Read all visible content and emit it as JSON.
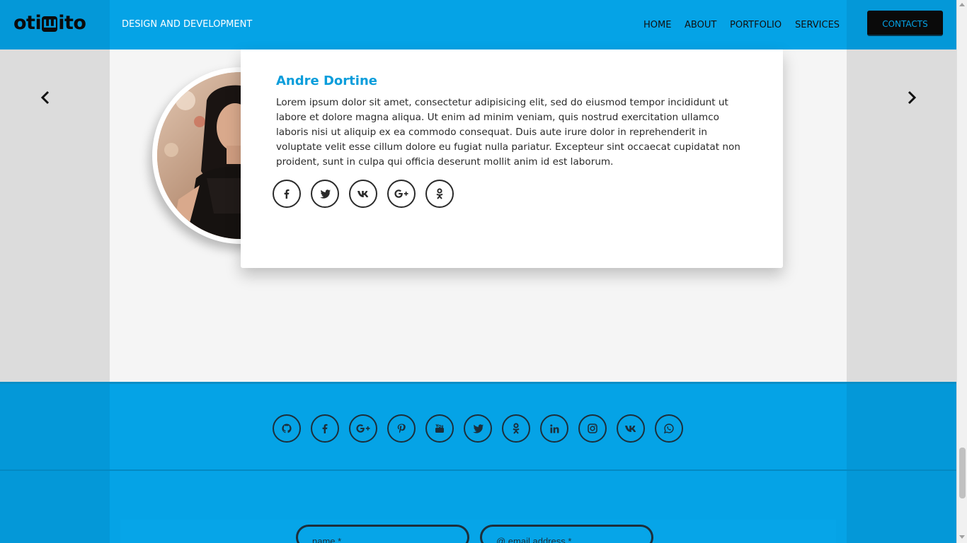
{
  "header": {
    "logo_left": "oti",
    "logo_mid": "Ш",
    "logo_right": "ito",
    "tagline": "DESIGN AND DEVELOPMENT",
    "nav": [
      "HOME",
      "ABOUT",
      "PORTFOLIO",
      "SERVICES"
    ],
    "contacts_label": "CONTACTS"
  },
  "testimonial": {
    "name": "Andre Dortine",
    "text": "Lorem ipsum dolor sit amet, consectetur adipisicing elit, sed do eiusmod tempor incididunt ut labore et dolore magna aliqua. Ut enim ad minim veniam, quis nostrud exercitation ullamco laboris nisi ut aliquip ex ea commodo consequat. Duis aute irure dolor in reprehenderit in voluptate velit esse cillum dolore eu fugiat nulla pariatur. Excepteur sint occaecat cupidatat non proident, sunt in culpa qui officia deserunt mollit anim id est laborum.",
    "social_icons": [
      "facebook-icon",
      "twitter-icon",
      "vk-icon",
      "google-plus-icon",
      "odnoklassniki-icon"
    ]
  },
  "carousel": {
    "prev_icon": "chevron-left-icon",
    "next_icon": "chevron-right-icon"
  },
  "footer": {
    "social_icons": [
      "github-icon",
      "facebook-icon",
      "google-plus-icon",
      "pinterest-icon",
      "youtube-icon",
      "twitter-icon",
      "odnoklassniki-icon",
      "linkedin-icon",
      "instagram-icon",
      "vk-icon",
      "whatsapp-icon"
    ],
    "form": {
      "name_placeholder": "name *",
      "email_placeholder": "@ email address *"
    }
  },
  "colors": {
    "brand_blue": "#05a3e6",
    "dark_blue_band": "#0498d8",
    "name_accent": "#0a9ddb",
    "text_dark": "#2a2a2a"
  }
}
